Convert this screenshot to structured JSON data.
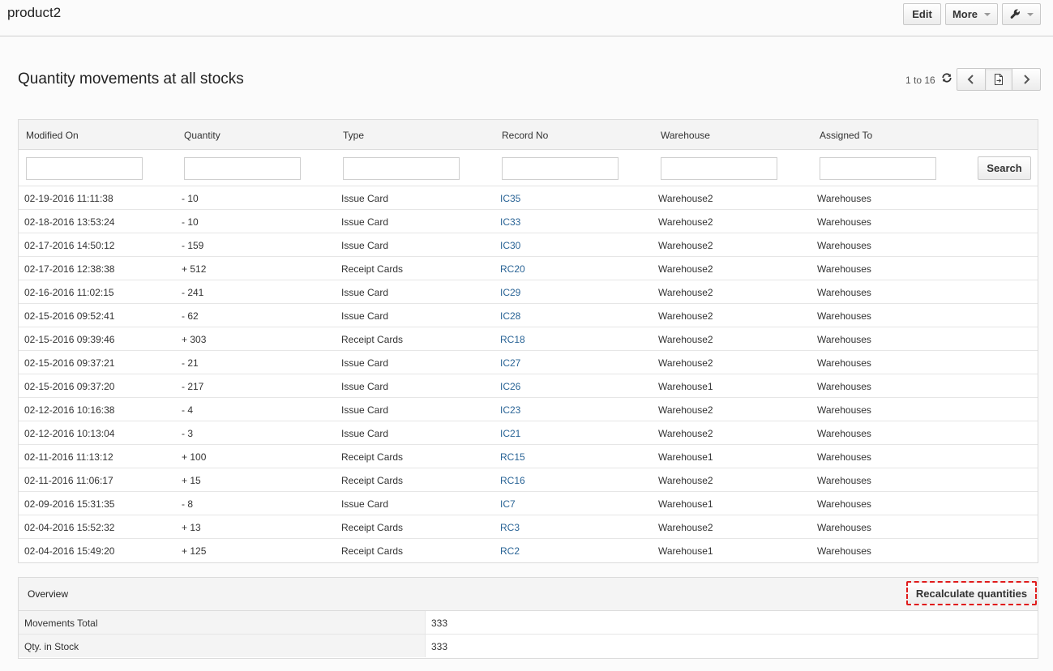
{
  "header": {
    "record_name": "product2",
    "edit_label": "Edit",
    "more_label": "More"
  },
  "block": {
    "title": "Quantity movements at all stocks",
    "pager_text": "1 to 16"
  },
  "table": {
    "columns": [
      "Modified On",
      "Quantity",
      "Type",
      "Record No",
      "Warehouse",
      "Assigned To"
    ],
    "search_label": "Search",
    "filters": [
      "",
      "",
      "",
      "",
      "",
      ""
    ],
    "rows": [
      [
        "02-19-2016 11:11:38",
        "- 10",
        "Issue Card",
        "IC35",
        "Warehouse2",
        "Warehouses"
      ],
      [
        "02-18-2016 13:53:24",
        "- 10",
        "Issue Card",
        "IC33",
        "Warehouse2",
        "Warehouses"
      ],
      [
        "02-17-2016 14:50:12",
        "- 159",
        "Issue Card",
        "IC30",
        "Warehouse2",
        "Warehouses"
      ],
      [
        "02-17-2016 12:38:38",
        "+ 512",
        "Receipt Cards",
        "RC20",
        "Warehouse2",
        "Warehouses"
      ],
      [
        "02-16-2016 11:02:15",
        "- 241",
        "Issue Card",
        "IC29",
        "Warehouse2",
        "Warehouses"
      ],
      [
        "02-15-2016 09:52:41",
        "- 62",
        "Issue Card",
        "IC28",
        "Warehouse2",
        "Warehouses"
      ],
      [
        "02-15-2016 09:39:46",
        "+ 303",
        "Receipt Cards",
        "RC18",
        "Warehouse2",
        "Warehouses"
      ],
      [
        "02-15-2016 09:37:21",
        "- 21",
        "Issue Card",
        "IC27",
        "Warehouse2",
        "Warehouses"
      ],
      [
        "02-15-2016 09:37:20",
        "- 217",
        "Issue Card",
        "IC26",
        "Warehouse1",
        "Warehouses"
      ],
      [
        "02-12-2016 10:16:38",
        "- 4",
        "Issue Card",
        "IC23",
        "Warehouse2",
        "Warehouses"
      ],
      [
        "02-12-2016 10:13:04",
        "- 3",
        "Issue Card",
        "IC21",
        "Warehouse2",
        "Warehouses"
      ],
      [
        "02-11-2016 11:13:12",
        "+ 100",
        "Receipt Cards",
        "RC15",
        "Warehouse1",
        "Warehouses"
      ],
      [
        "02-11-2016 11:06:17",
        "+ 15",
        "Receipt Cards",
        "RC16",
        "Warehouse2",
        "Warehouses"
      ],
      [
        "02-09-2016 15:31:35",
        "- 8",
        "Issue Card",
        "IC7",
        "Warehouse1",
        "Warehouses"
      ],
      [
        "02-04-2016 15:52:32",
        "+ 13",
        "Receipt Cards",
        "RC3",
        "Warehouse2",
        "Warehouses"
      ],
      [
        "02-04-2016 15:49:20",
        "+ 125",
        "Receipt Cards",
        "RC2",
        "Warehouse1",
        "Warehouses"
      ]
    ]
  },
  "overview": {
    "title": "Overview",
    "recalc_label": "Recalculate quantities",
    "rows": [
      {
        "label": "Movements Total",
        "value": "333"
      },
      {
        "label": "Qty. in Stock",
        "value": "333"
      }
    ]
  },
  "colors": {
    "link": "#2a6496",
    "highlight_border": "#e01b1b"
  }
}
